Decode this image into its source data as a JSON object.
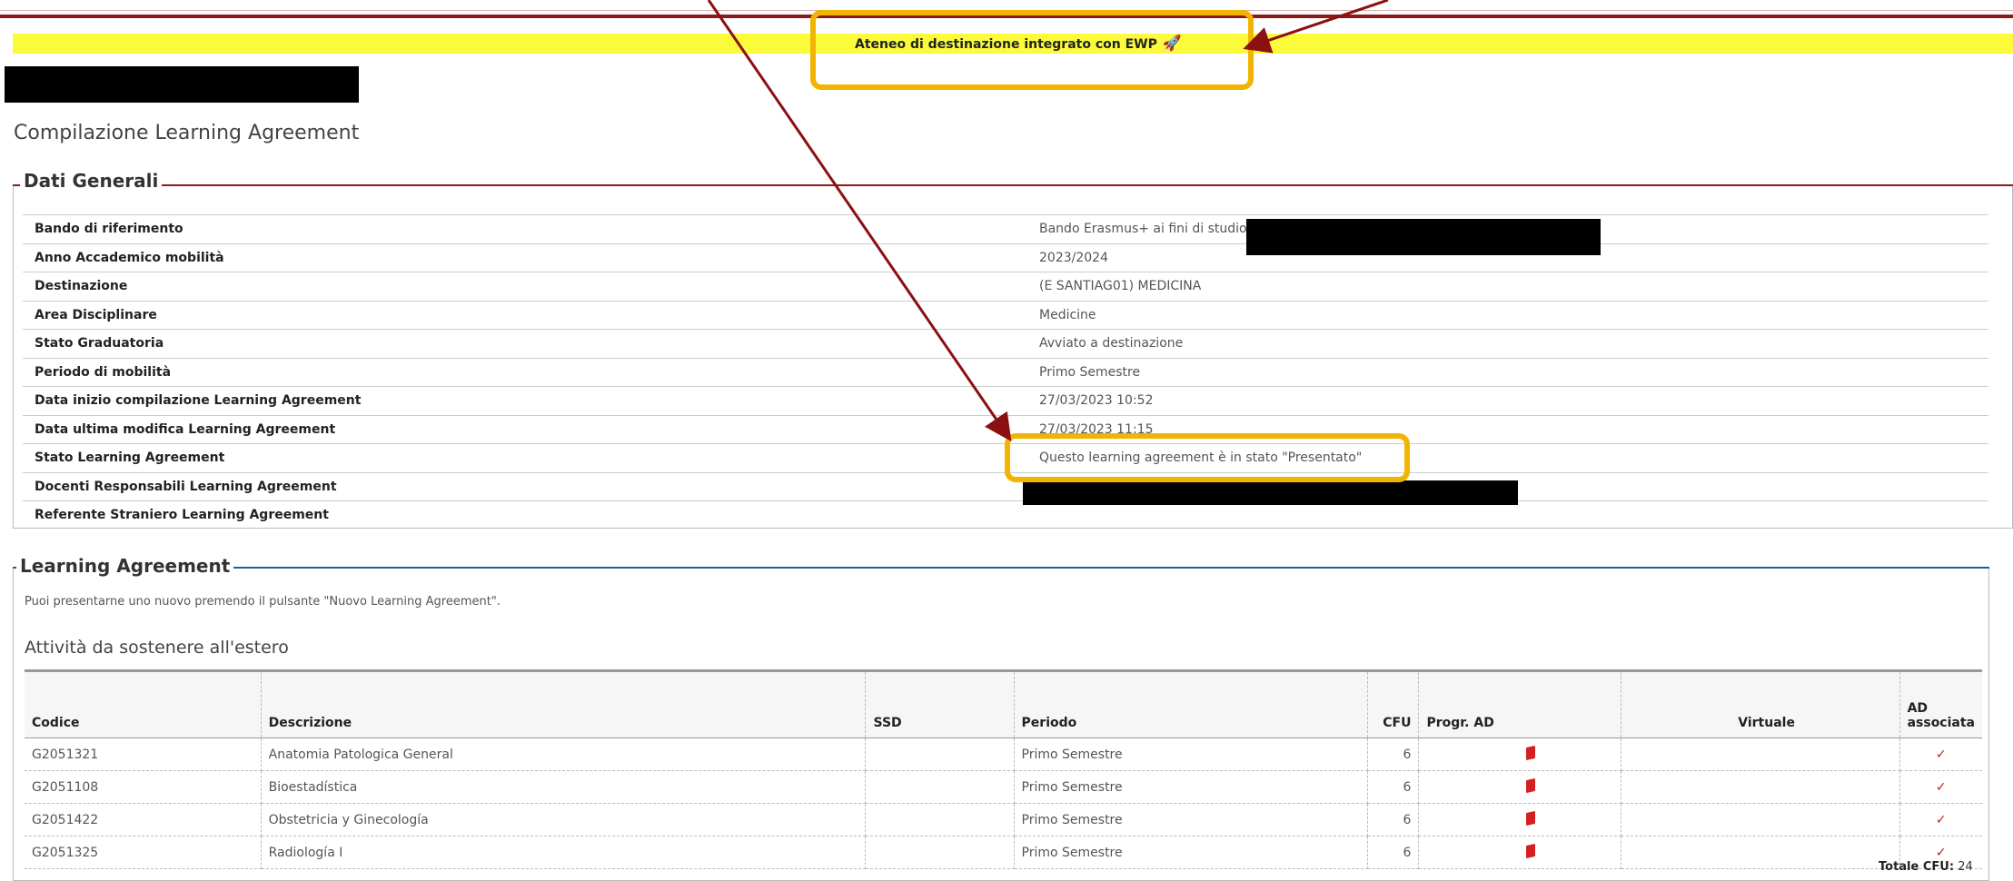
{
  "banner": {
    "text": "Ateneo di destinazione integrato con EWP",
    "icon": "paper-plane-icon"
  },
  "page": {
    "title": "Compilazione Learning Agreement"
  },
  "dati_generali": {
    "legend": "Dati Generali",
    "rows": [
      {
        "label": "Bando di riferimento",
        "value": "Bando Erasmus+ ai fini di studio 2"
      },
      {
        "label": "Anno Accademico mobilità",
        "value": "2023/2024"
      },
      {
        "label": "Destinazione",
        "value": "(E SANTIAG01) MEDICINA"
      },
      {
        "label": "Area Disciplinare",
        "value": "Medicine"
      },
      {
        "label": "Stato Graduatoria",
        "value": "Avviato a destinazione"
      },
      {
        "label": "Periodo di mobilità",
        "value": "Primo Semestre"
      },
      {
        "label": "Data inizio compilazione Learning Agreement",
        "value": "27/03/2023 10:52"
      },
      {
        "label": "Data ultima modifica Learning Agreement",
        "value": "27/03/2023 11:15"
      },
      {
        "label": "Stato Learning Agreement",
        "value": "Questo learning agreement è in stato \"Presentato\""
      },
      {
        "label": "Docenti Responsabili Learning Agreement",
        "value": ""
      },
      {
        "label": "Referente Straniero Learning Agreement",
        "value": ""
      }
    ]
  },
  "learning_agreement": {
    "legend": "Learning Agreement",
    "note": "Puoi presentarne uno nuovo premendo il pulsante \"Nuovo Learning Agreement\".",
    "subtitle": "Attività da sostenere all'estero",
    "headers": {
      "codice": "Codice",
      "descrizione": "Descrizione",
      "ssd": "SSD",
      "periodo": "Periodo",
      "cfu": "CFU",
      "prog": "Progr. AD",
      "virtuale": "Virtuale",
      "ad1": "AD",
      "ad2": "associata"
    },
    "rows": [
      {
        "codice": "G2051321",
        "descrizione": "Anatomia Patologica General",
        "periodo": "Primo Semestre",
        "cfu": "6"
      },
      {
        "codice": "G2051108",
        "descrizione": "Bioestadística",
        "periodo": "Primo Semestre",
        "cfu": "6"
      },
      {
        "codice": "G2051422",
        "descrizione": "Obstetricia y Ginecología",
        "periodo": "Primo Semestre",
        "cfu": "6"
      },
      {
        "codice": "G2051325",
        "descrizione": "Radiología I",
        "periodo": "Primo Semestre",
        "cfu": "6"
      }
    ],
    "totale_label": "Totale CFU:",
    "totale_value": "24"
  },
  "colors": {
    "accent_red": "#8b1a1a",
    "accent_blue": "#1f5f8f",
    "highlight": "#f2b400",
    "banner_yellow": "#fbfb3c"
  }
}
